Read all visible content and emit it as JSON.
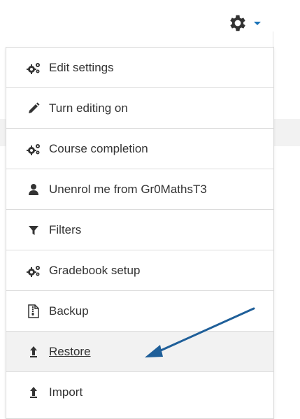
{
  "menu": {
    "items": [
      {
        "label": "Edit settings",
        "icon": "cogs-icon"
      },
      {
        "label": "Turn editing on",
        "icon": "pencil-icon"
      },
      {
        "label": "Course completion",
        "icon": "cogs-icon"
      },
      {
        "label": "Unenrol me from Gr0MathsT3",
        "icon": "user-icon"
      },
      {
        "label": "Filters",
        "icon": "filter-icon"
      },
      {
        "label": "Gradebook setup",
        "icon": "cogs-icon"
      },
      {
        "label": "Backup",
        "icon": "file-archive-icon"
      },
      {
        "label": "Restore",
        "icon": "upload-icon"
      },
      {
        "label": "Import",
        "icon": "upload-icon"
      }
    ]
  },
  "colors": {
    "accent": "#1a73b8",
    "arrow": "#1f5f99",
    "icon": "#333333"
  }
}
